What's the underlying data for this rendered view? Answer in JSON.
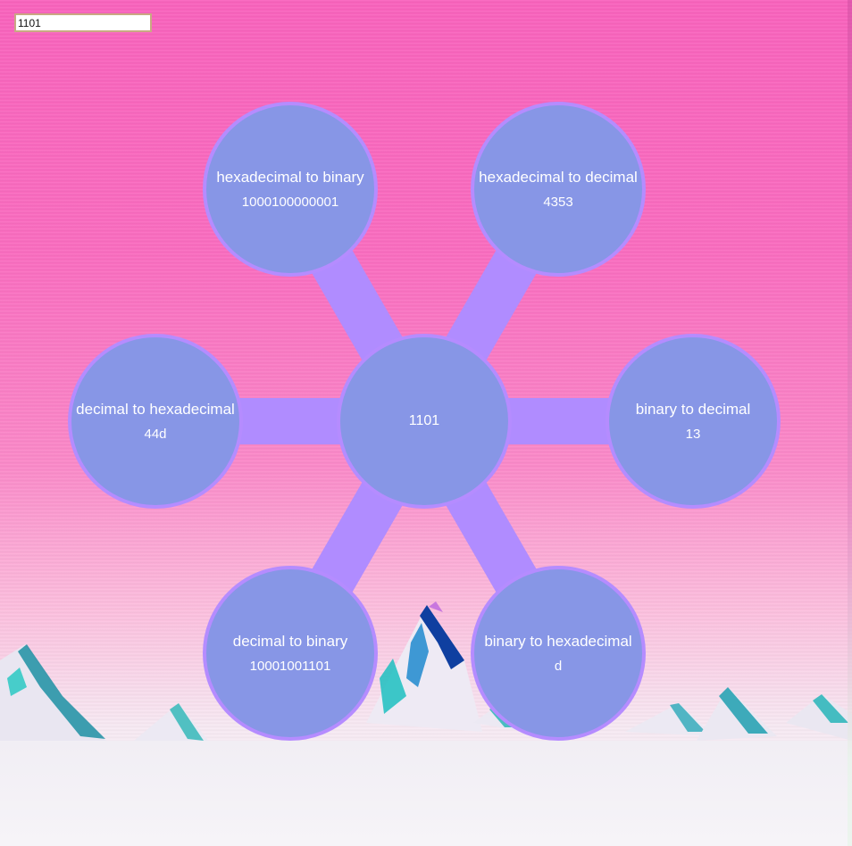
{
  "input": {
    "value": "1101"
  },
  "center": {
    "value": "1101"
  },
  "conversions": [
    {
      "id": "hex-to-bin",
      "label": "hexadecimal to binary",
      "value": "1000100000001"
    },
    {
      "id": "hex-to-dec",
      "label": "hexadecimal to decimal",
      "value": "4353"
    },
    {
      "id": "dec-to-hex",
      "label": "decimal to hexadecimal",
      "value": "44d"
    },
    {
      "id": "bin-to-dec",
      "label": "binary to decimal",
      "value": "13"
    },
    {
      "id": "dec-to-bin",
      "label": "decimal to binary",
      "value": "10001001101"
    },
    {
      "id": "bin-to-hex",
      "label": "binary to hexadecimal",
      "value": "d"
    }
  ],
  "colors": {
    "node_fill": "#8796e6",
    "node_border": "#b58cff",
    "connector": "#b08cff",
    "background_top": "#f963bd"
  }
}
